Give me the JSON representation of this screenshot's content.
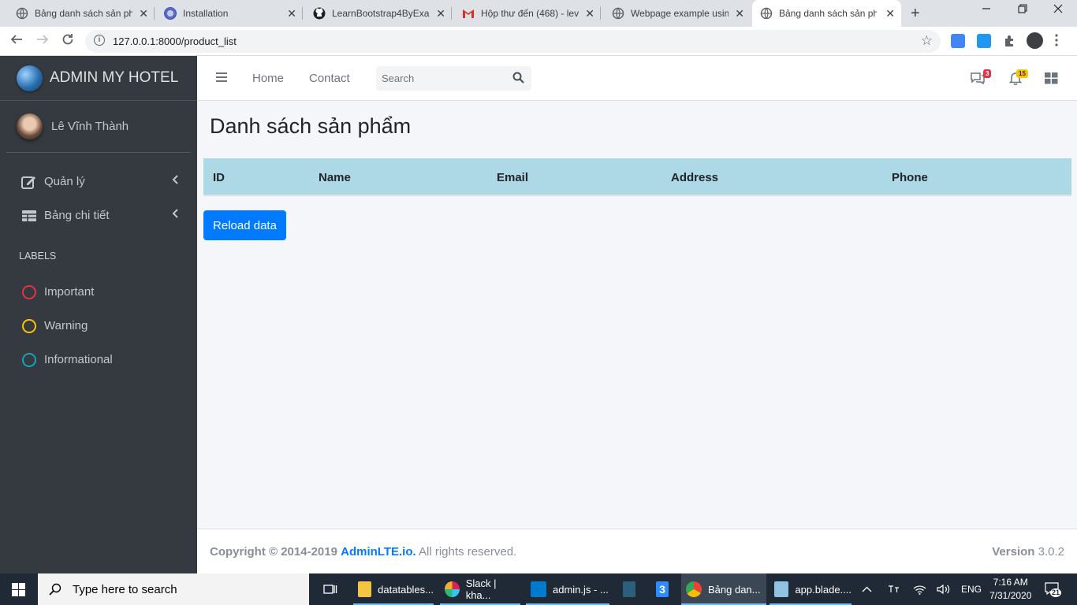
{
  "browser": {
    "tabs": [
      {
        "title": "Bảng danh sách sản phẩ",
        "active": false
      },
      {
        "title": "Installation",
        "active": false
      },
      {
        "title": "LearnBootstrap4ByExam",
        "active": false
      },
      {
        "title": "Hộp thư đến (468) - lev",
        "active": false
      },
      {
        "title": "Webpage example using",
        "active": false
      },
      {
        "title": "Bảng danh sách sản phẩ",
        "active": true
      }
    ],
    "url": "127.0.0.1:8000/product_list"
  },
  "sidebar": {
    "brand": "ADMIN MY HOTEL",
    "user": "Lê Vĩnh Thành",
    "menu": [
      {
        "label": "Quản lý",
        "icon": "edit-icon"
      },
      {
        "label": "Bảng chi tiết",
        "icon": "table-icon"
      }
    ],
    "labels_header": "LABELS",
    "labels": [
      {
        "label": "Important",
        "color": "#dc3545"
      },
      {
        "label": "Warning",
        "color": "#ffc107"
      },
      {
        "label": "Informational",
        "color": "#17a2b8"
      }
    ]
  },
  "header": {
    "nav": [
      "Home",
      "Contact"
    ],
    "search_placeholder": "Search",
    "messages_count": "3",
    "notifications_count": "15"
  },
  "content": {
    "title": "Danh sách sản phẩm",
    "columns": [
      "ID",
      "Name",
      "Email",
      "Address",
      "Phone"
    ],
    "reload_label": "Reload data"
  },
  "footer": {
    "copyright": "Copyright © 2014-2019",
    "link": "AdminLTE.io.",
    "rights": "All rights reserved.",
    "version_label": "Version",
    "version": "3.0.2"
  },
  "taskbar": {
    "search": "Type here to search",
    "apps": [
      "datatables...",
      "Slack | kha...",
      "admin.js - ...",
      "Bảng dan...",
      "app.blade...."
    ],
    "lang": "ENG",
    "time": "7:16 AM",
    "date": "7/31/2020",
    "notifications": "21"
  },
  "colors": {
    "sidebar_bg": "#343a40",
    "table_header_bg": "#add8e6",
    "primary": "#007bff"
  }
}
